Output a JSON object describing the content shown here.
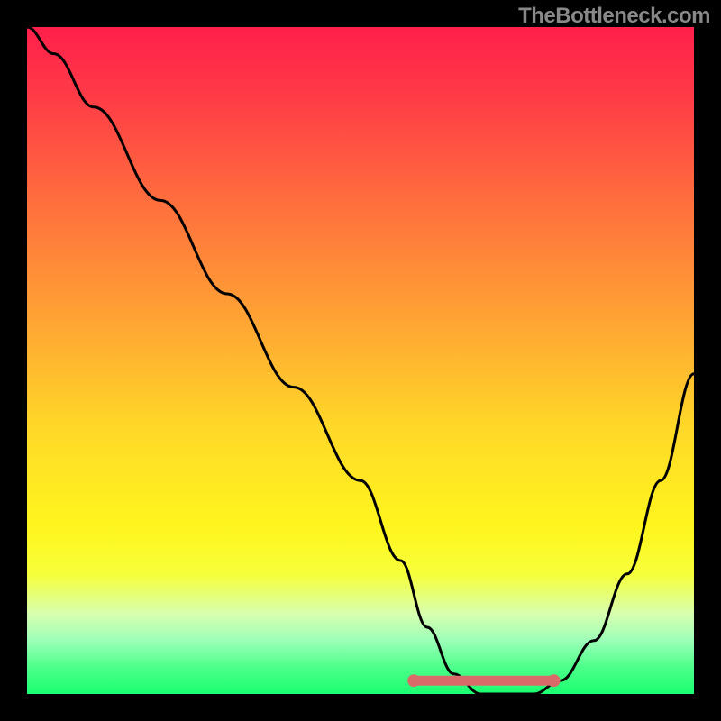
{
  "watermark": "TheBottleneck.com",
  "chart_data": {
    "type": "line",
    "title": "",
    "xlabel": "",
    "ylabel": "",
    "xlim": [
      0,
      100
    ],
    "ylim": [
      0,
      100
    ],
    "grid": false,
    "series": [
      {
        "name": "curve",
        "x": [
          0,
          4,
          10,
          20,
          30,
          40,
          50,
          56,
          60,
          64,
          68,
          72,
          76,
          80,
          85,
          90,
          95,
          100
        ],
        "values": [
          100,
          96,
          88,
          74,
          60,
          46,
          32,
          20,
          10,
          3,
          0,
          0,
          0,
          2,
          8,
          18,
          32,
          48
        ]
      }
    ],
    "annotations": [
      {
        "name": "flat-region-marker",
        "type": "segment",
        "x_start": 58,
        "x_end": 79,
        "y": 2,
        "style": "thick-salmon-dots"
      }
    ],
    "background": {
      "type": "vertical-gradient",
      "stops": [
        {
          "pos": 0.0,
          "color": "#ff1f4b"
        },
        {
          "pos": 0.25,
          "color": "#ff6a3e"
        },
        {
          "pos": 0.6,
          "color": "#ffd828"
        },
        {
          "pos": 0.82,
          "color": "#f6ff3a"
        },
        {
          "pos": 0.92,
          "color": "#9cffb8"
        },
        {
          "pos": 1.0,
          "color": "#1aff70"
        }
      ]
    }
  }
}
